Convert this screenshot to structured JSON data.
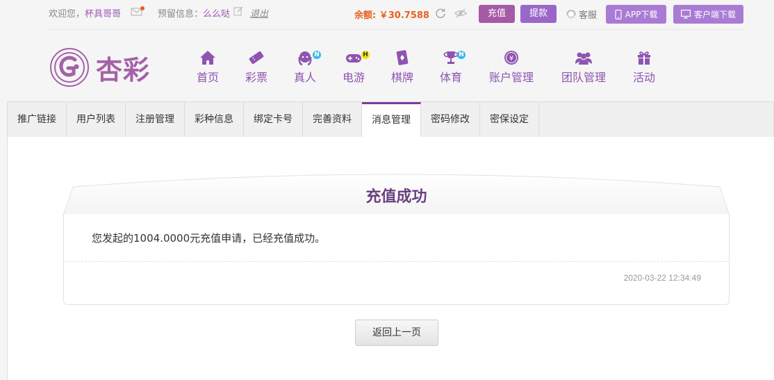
{
  "topbar": {
    "welcome_prefix": "欢迎您，",
    "username": "杯具哥哥",
    "reserve_prefix": "预留信息：",
    "reserve_value": "么么哒",
    "logout_label": "退出",
    "balance_label": "余额: ￥30.7588",
    "deposit_label": "充值",
    "withdraw_label": "提款",
    "service_label": "客服",
    "app_download_label": "APP下载",
    "client_download_label": "客户端下载"
  },
  "brand": {
    "name": "杏彩"
  },
  "nav": {
    "items": [
      {
        "label": "首页",
        "icon": "home-icon"
      },
      {
        "label": "彩票",
        "icon": "ticket-icon"
      },
      {
        "label": "真人",
        "icon": "live-dealer-icon",
        "badge": "N"
      },
      {
        "label": "电游",
        "icon": "gamepad-icon",
        "badge": "H"
      },
      {
        "label": "棋牌",
        "icon": "cards-icon"
      },
      {
        "label": "体育",
        "icon": "trophy-icon",
        "badge": "N"
      },
      {
        "label": "账户管理",
        "icon": "yen-coin-icon"
      },
      {
        "label": "团队管理",
        "icon": "team-icon"
      },
      {
        "label": "活动",
        "icon": "gift-icon"
      }
    ]
  },
  "tabs": [
    {
      "label": "推广链接"
    },
    {
      "label": "用户列表"
    },
    {
      "label": "注册管理"
    },
    {
      "label": "彩种信息"
    },
    {
      "label": "绑定卡号"
    },
    {
      "label": "完善资料"
    },
    {
      "label": "消息管理",
      "active": true
    },
    {
      "label": "密码修改"
    },
    {
      "label": "密保设定"
    }
  ],
  "message": {
    "title": "充值成功",
    "body": "您发起的1004.0000元充值申请，已经充值成功。",
    "timestamp": "2020-03-22 12:34:49"
  },
  "back_button_label": "返回上一页",
  "colors": {
    "accent": "#8e54b0",
    "brand": "#a461a8",
    "balance": "#e8611e",
    "badge_n": "#3bb8e8",
    "badge_h": "#f5e400"
  }
}
